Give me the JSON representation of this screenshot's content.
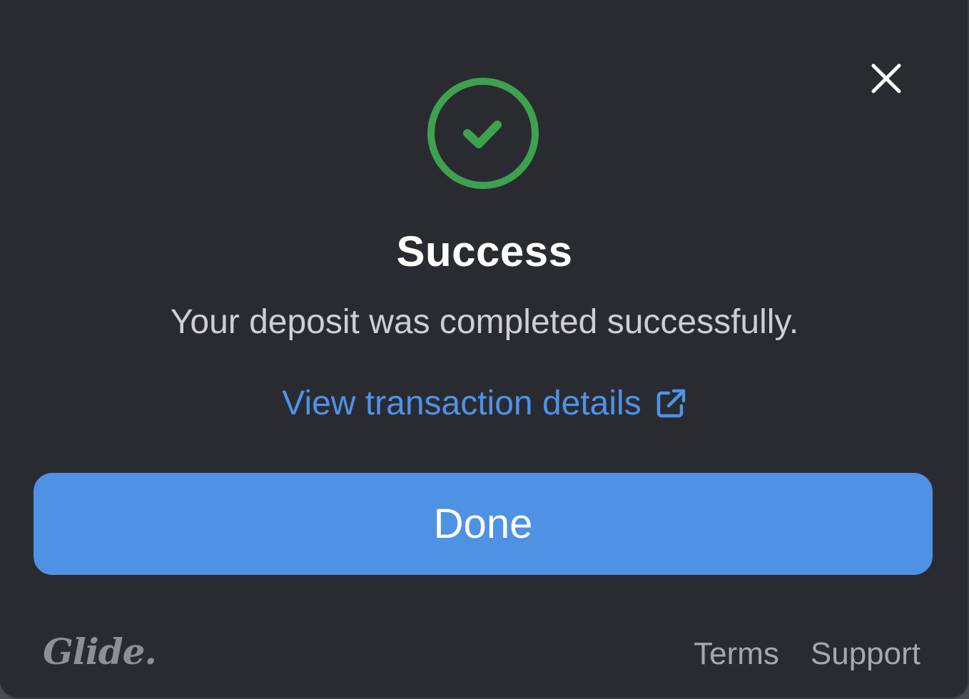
{
  "dialog": {
    "title": "Success",
    "message": "Your deposit was completed successfully.",
    "link_label": "View transaction details",
    "done_label": "Done",
    "close_icon": "close-icon",
    "status_icon": "check-circle-icon",
    "colors": {
      "background": "#2a2b31",
      "success": "#3ea14f",
      "link": "#4e93ea",
      "primary_button": "#4f92e3"
    }
  },
  "footer": {
    "logo_text": "Glide.",
    "links": [
      "Terms",
      "Support"
    ]
  }
}
